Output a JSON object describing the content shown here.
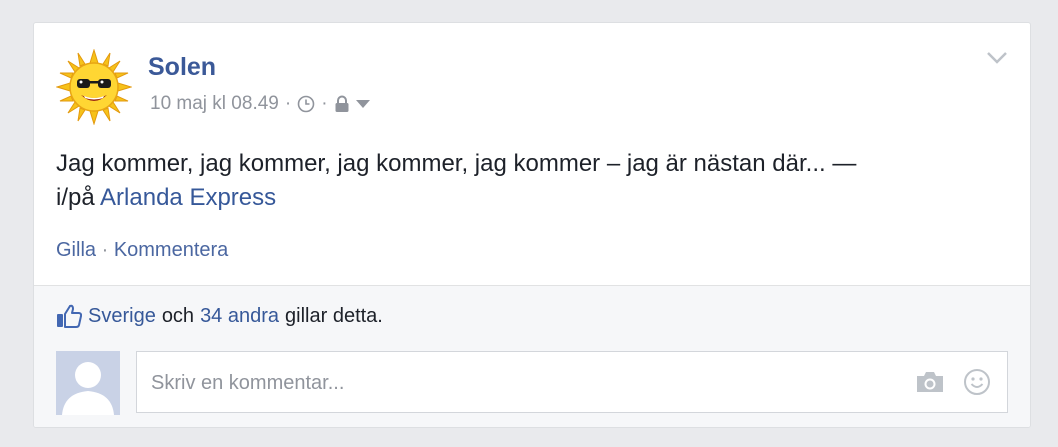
{
  "post": {
    "author": "Solen",
    "timestamp": "10 maj kl 08.49",
    "meta_separator": "·",
    "text": "Jag kommer, jag kommer, jag kommer, jag kommer – jag är nästan där... —",
    "location_prefix": "i/på",
    "location_link": "Arlanda Express",
    "icons": {
      "clock": "clock-icon",
      "privacy": "lock-icon",
      "audience_dropdown": "caret-down-icon",
      "options": "chevron-down-icon",
      "avatar": "sun-avatar"
    }
  },
  "actions": {
    "like": "Gilla",
    "separator": "·",
    "comment": "Kommentera"
  },
  "likes": {
    "name_link": "Sverige",
    "conjunction": "och",
    "others_link": "34 andra",
    "suffix": "gillar detta."
  },
  "comment": {
    "placeholder": "Skriv en kommentar...",
    "value": ""
  },
  "colors": {
    "link": "#365899",
    "author": "#3b5998",
    "meta": "#90949c",
    "background": "#e9eaed",
    "footer": "#f6f7f9"
  }
}
